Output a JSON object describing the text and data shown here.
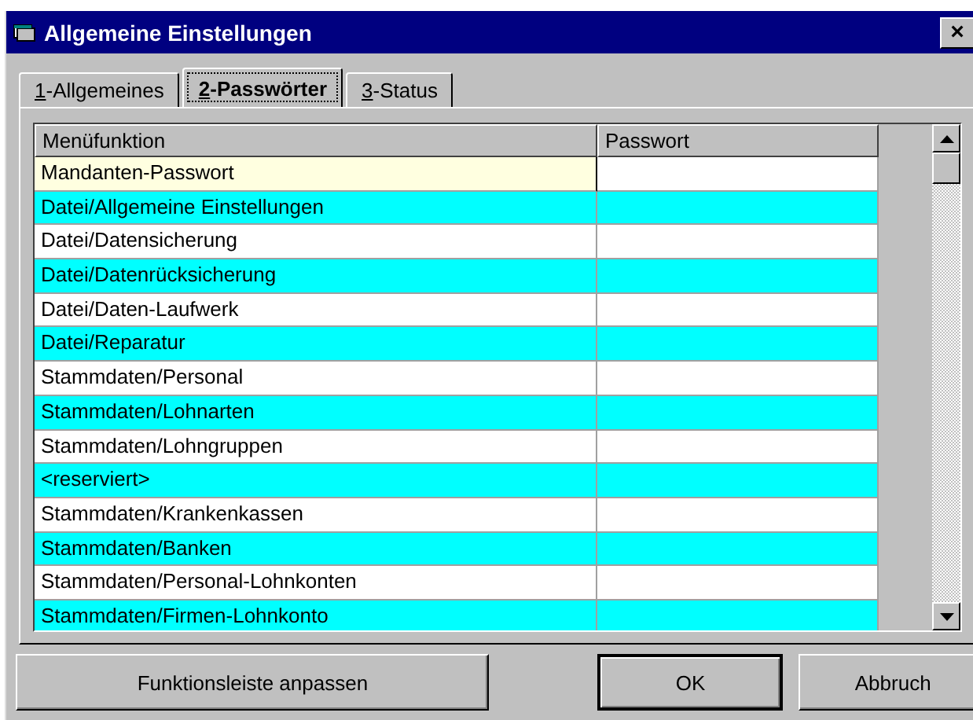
{
  "window": {
    "title": "Allgemeine Einstellungen",
    "close": "×"
  },
  "tabs": [
    {
      "label": "1-Allgemeines",
      "selected": false
    },
    {
      "label": "2-Passwörter",
      "selected": true
    },
    {
      "label": "3-Status",
      "selected": false
    }
  ],
  "table": {
    "columns": [
      "Menüfunktion",
      "Passwort"
    ],
    "rows": [
      {
        "menu_function": "Mandanten-Passwort",
        "shaded": false,
        "selected": true
      },
      {
        "menu_function": "Datei/Allgemeine Einstellungen",
        "shaded": true,
        "selected": false
      },
      {
        "menu_function": "Datei/Datensicherung",
        "shaded": false,
        "selected": false
      },
      {
        "menu_function": "Datei/Datenrücksicherung",
        "shaded": true,
        "selected": false
      },
      {
        "menu_function": "Datei/Daten-Laufwerk",
        "shaded": false,
        "selected": false
      },
      {
        "menu_function": "Datei/Reparatur",
        "shaded": true,
        "selected": false
      },
      {
        "menu_function": "Stammdaten/Personal",
        "shaded": false,
        "selected": false
      },
      {
        "menu_function": "Stammdaten/Lohnarten",
        "shaded": true,
        "selected": false
      },
      {
        "menu_function": "Stammdaten/Lohngruppen",
        "shaded": false,
        "selected": false
      },
      {
        "menu_function": "<reserviert>",
        "shaded": true,
        "selected": false
      },
      {
        "menu_function": "Stammdaten/Krankenkassen",
        "shaded": false,
        "selected": false
      },
      {
        "menu_function": "Stammdaten/Banken",
        "shaded": true,
        "selected": false
      },
      {
        "menu_function": "Stammdaten/Personal-Lohnkonten",
        "shaded": false,
        "selected": false
      },
      {
        "menu_function": "Stammdaten/Firmen-Lohnkonto",
        "shaded": true,
        "selected": false
      }
    ]
  },
  "buttons": [
    {
      "label": "Funktionsleiste anpassen",
      "kind": "wide"
    },
    {
      "label": "OK",
      "kind": "default"
    },
    {
      "label": "Abbruch",
      "kind": "normal"
    }
  ]
}
